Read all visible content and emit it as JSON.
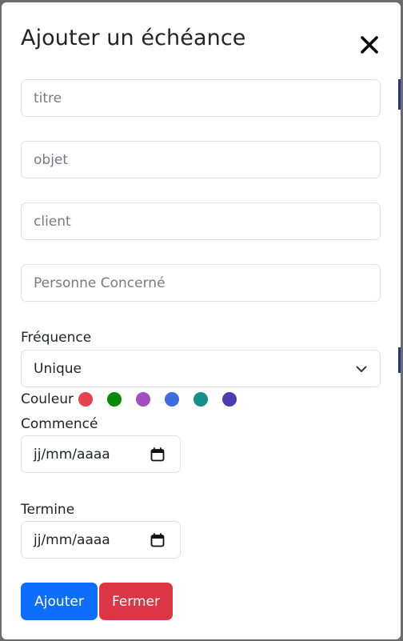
{
  "modal": {
    "title": "Ajouter un échéance",
    "close_icon": "close-icon"
  },
  "fields": {
    "titre": {
      "placeholder": "titre",
      "value": ""
    },
    "objet": {
      "placeholder": "objet",
      "value": ""
    },
    "client": {
      "placeholder": "client",
      "value": ""
    },
    "personne": {
      "placeholder": "Personne Concerné",
      "value": ""
    }
  },
  "frequence": {
    "label": "Fréquence",
    "selected": "Unique",
    "icon": "chevron-down-icon"
  },
  "couleur": {
    "label": "Couleur",
    "colors": [
      "#e5424d",
      "#0a8a0a",
      "#a050c0",
      "#3d6ee0",
      "#148f8a",
      "#4a3fb0"
    ]
  },
  "commence": {
    "label": "Commencé",
    "value": "jj/mm/aaaa",
    "icon": "calendar-icon"
  },
  "termine": {
    "label": "Termine",
    "value": "jj/mm/aaaa",
    "icon": "calendar-icon"
  },
  "actions": {
    "add_label": "Ajouter",
    "close_label": "Fermer"
  }
}
